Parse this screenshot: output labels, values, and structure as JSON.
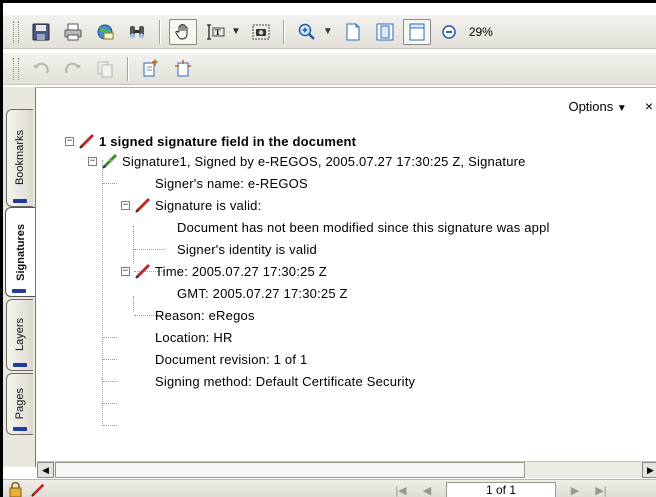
{
  "toolbar1": {
    "icons": [
      "save-icon",
      "print-icon",
      "email-icon",
      "find-icon",
      "hand-tool-icon",
      "select-text-icon",
      "snapshot-icon",
      "zoom-in-icon",
      "actual-size-icon",
      "fit-page-icon",
      "fit-width-icon",
      "zoom-out-icon"
    ],
    "zoom_value": "29%"
  },
  "toolbar2": {
    "icons": [
      "rotate-left-icon",
      "rotate-right-icon",
      "copy-icon",
      "insert-pages-icon",
      "extract-pages-icon"
    ]
  },
  "side_tabs": [
    "Bookmarks",
    "Signatures",
    "Layers",
    "Pages"
  ],
  "active_tab": "Signatures",
  "panel": {
    "options_label": "Options",
    "close_label": "×"
  },
  "tree": {
    "root": "1 signed signature field in the document",
    "signature": "Signature1, Signed by e-REGOS, 2005.07.27 17:30:25 Z, Signature",
    "signer_name": "Signer's name: e-REGOS",
    "valid": "Signature is valid:",
    "not_modified": "Document has not been modified since this signature was appl",
    "identity_valid": "Signer's identity is valid",
    "time": "Time: 2005.07.27 17:30:25 Z",
    "gmt": "GMT: 2005.07.27 17:30:25 Z",
    "reason": "Reason: eRegos",
    "location": "Location: HR",
    "revision": "Document revision: 1 of 1",
    "method": "Signing method: Default Certificate Security"
  },
  "statusbar": {
    "page_indicator": "1 of 1"
  },
  "colors": {
    "accent_tab_mark": "#1f3c9c",
    "pen_red": "#c0262b",
    "pen_green": "#3a8b2c"
  }
}
